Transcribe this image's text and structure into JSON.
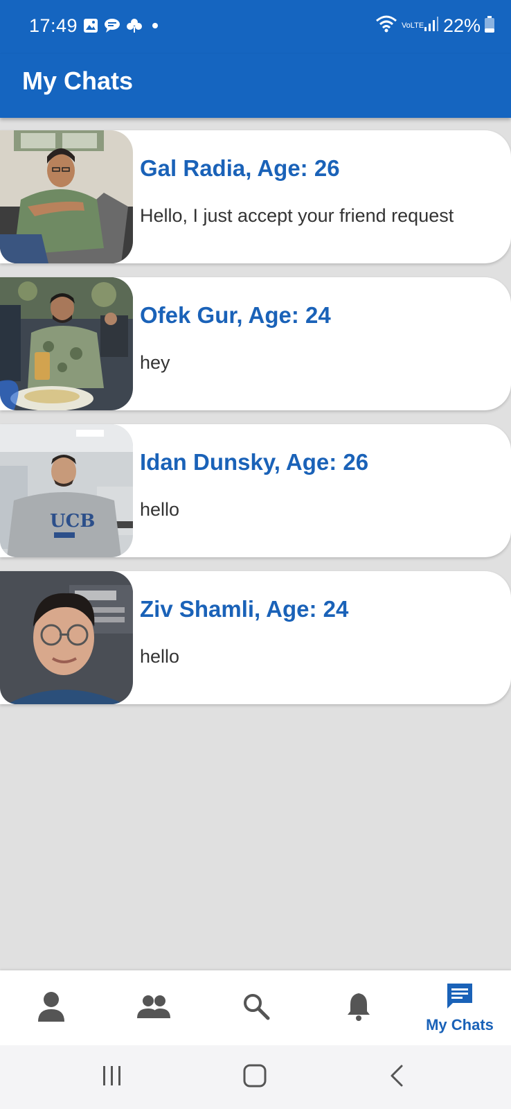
{
  "status_bar": {
    "time": "17:49",
    "battery": "22%",
    "network": "VoLTE",
    "left_icons": [
      "gallery-icon",
      "chat-bubble-icon",
      "clover-icon",
      "dot-icon"
    ],
    "right_icons": [
      "wifi-icon",
      "volte-icon",
      "signal-icon",
      "battery-icon"
    ],
    "background": "#1565c0"
  },
  "app_bar": {
    "title": "My Chats",
    "background": "#1565c0"
  },
  "chats": [
    {
      "name": "Gal Radia, Age: 26",
      "message": "Hello, I just accept your friend request",
      "avatar": "photo-gal-radia"
    },
    {
      "name": "Ofek Gur, Age: 24",
      "message": "hey",
      "avatar": "photo-ofek-gur"
    },
    {
      "name": "Idan Dunsky, Age: 26",
      "message": "hello",
      "avatar": "photo-idan-dunsky"
    },
    {
      "name": "Ziv Shamli, Age: 24",
      "message": "hello",
      "avatar": "photo-ziv-shamli"
    }
  ],
  "bottom_nav": {
    "items": [
      {
        "icon": "person-icon",
        "label": ""
      },
      {
        "icon": "group-icon",
        "label": ""
      },
      {
        "icon": "search-icon",
        "label": ""
      },
      {
        "icon": "bell-icon",
        "label": ""
      },
      {
        "icon": "chat-icon",
        "label": "My Chats",
        "active": true
      }
    ],
    "active_color": "#1a62b8",
    "inactive_color": "#555555"
  },
  "system_nav": {
    "buttons": [
      "recent-apps-icon",
      "home-icon",
      "back-icon"
    ]
  },
  "colors": {
    "primary": "#1565c0",
    "name_text": "#1a62b8",
    "page_background": "#e0e0e0"
  }
}
